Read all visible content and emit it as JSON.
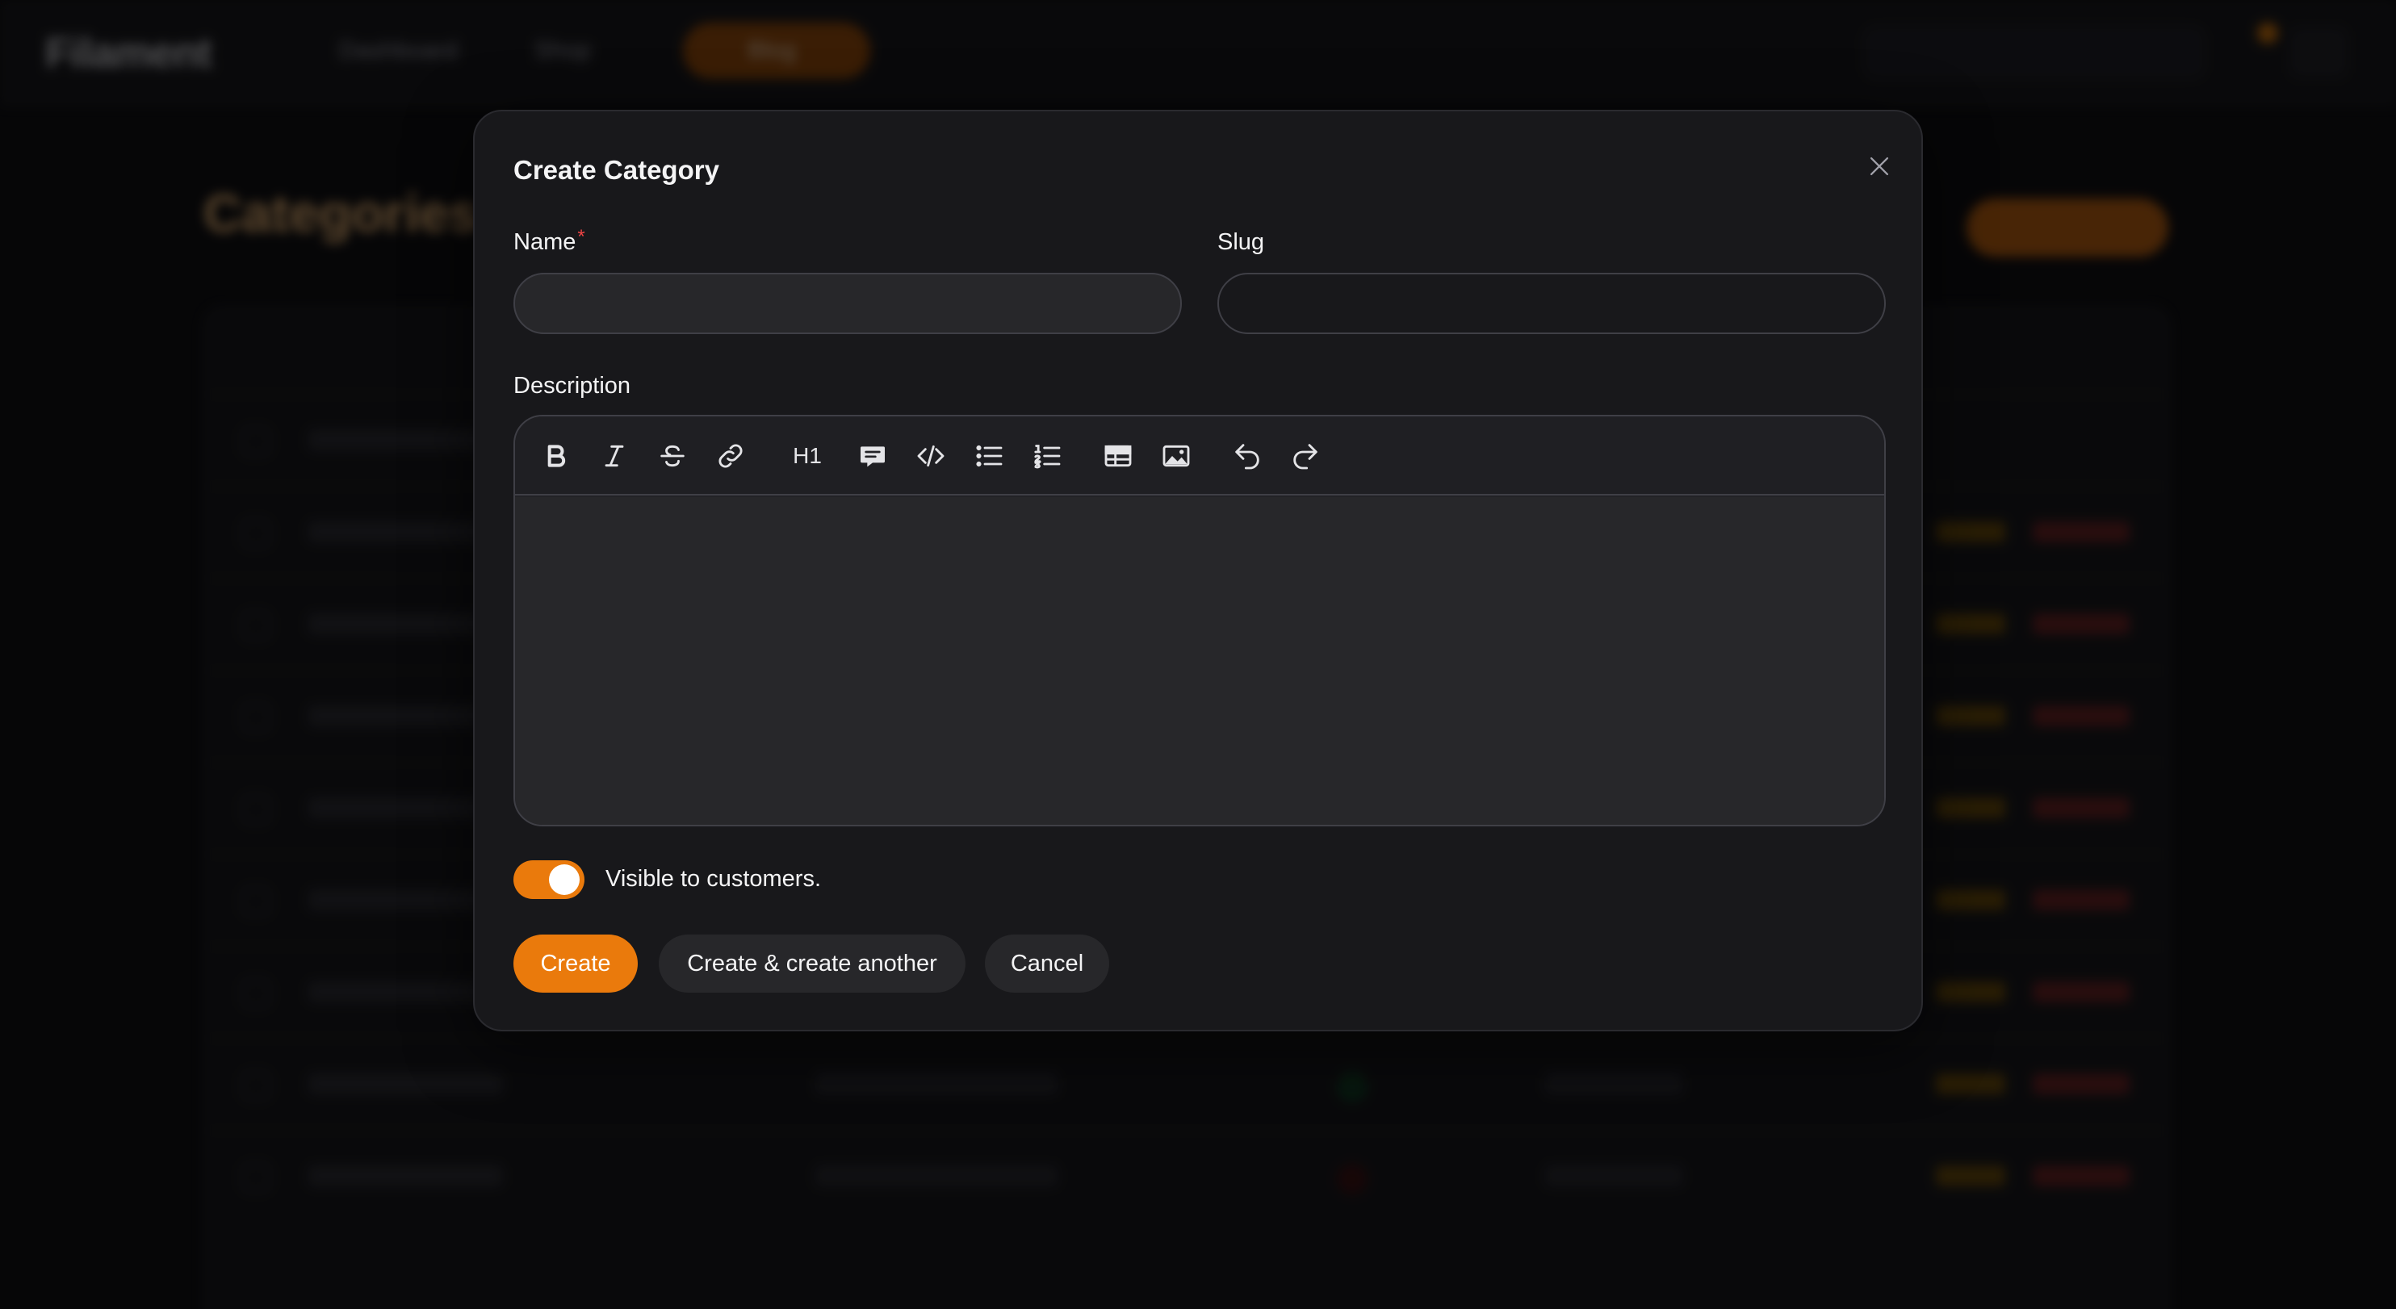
{
  "background": {
    "brand": "Filament",
    "nav": {
      "dashboard": "Dashboard",
      "shop": "Shop",
      "blog": "Blog"
    },
    "page_title": "Categories"
  },
  "modal": {
    "title": "Create Category",
    "name_label": "Name",
    "name_required_marker": "*",
    "name_value": "",
    "slug_label": "Slug",
    "slug_value": "",
    "description_label": "Description",
    "toolbar_icons": [
      "bold-icon",
      "italic-icon",
      "strike-icon",
      "link-icon",
      "heading-icon",
      "blockquote-icon",
      "code-icon",
      "bullet-list-icon",
      "ordered-list-icon",
      "table-icon",
      "image-icon",
      "undo-icon",
      "redo-icon"
    ],
    "heading_tool_label": "H1",
    "visible_toggle": {
      "label": "Visible to customers.",
      "checked": true
    },
    "buttons": {
      "create": "Create",
      "create_another": "Create & create another",
      "cancel": "Cancel"
    }
  },
  "colors": {
    "accent": "#ea7a0c",
    "modal_bg": "#18181b",
    "input_bg": "#27272a",
    "required": "#ef4444"
  }
}
